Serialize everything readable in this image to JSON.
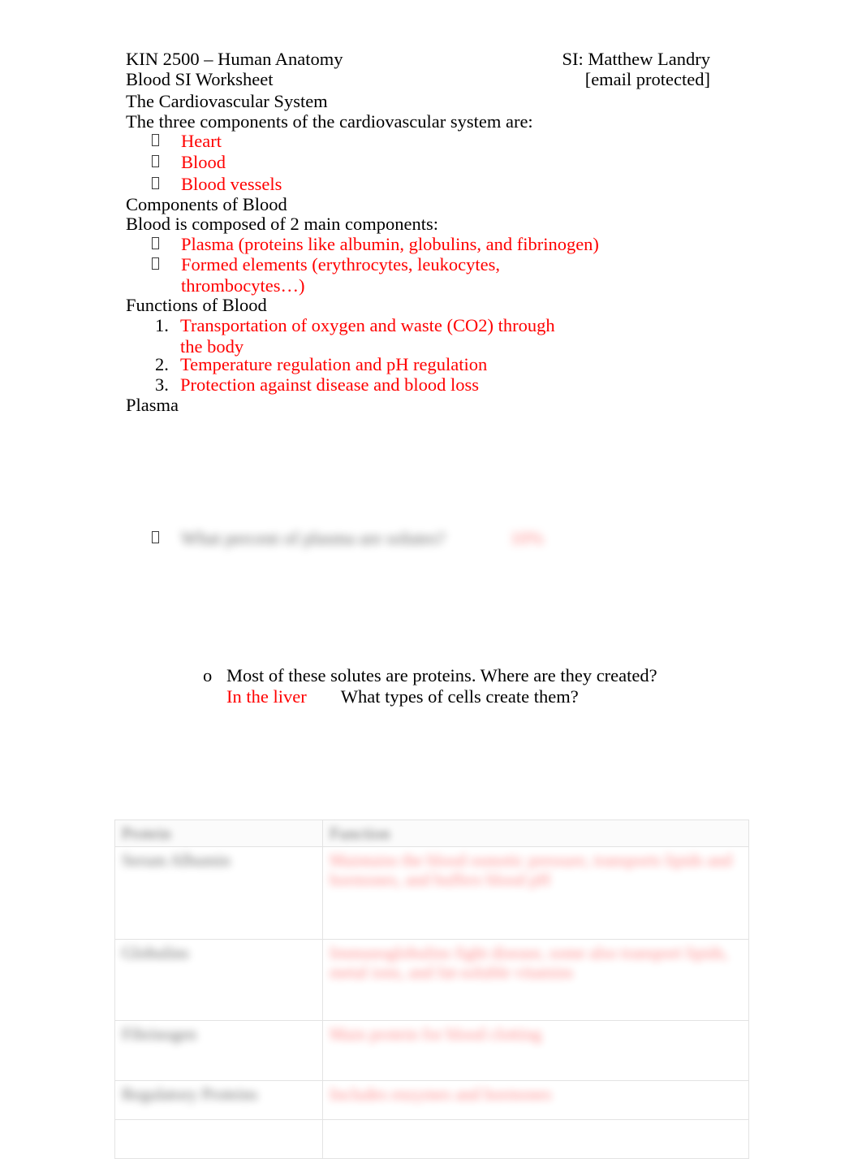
{
  "document": {
    "header": {
      "left_line1": "KIN 2500 – Human Anatomy",
      "right_line1": "SI: Matthew Landry",
      "left_line2": "Blood SI Worksheet",
      "right_line2": "[email protected]"
    },
    "section_cardiovascular": {
      "heading": "The Cardiovascular System",
      "prompt": "The three components of the cardiovascular system are:",
      "answers": [
        "Heart",
        "Blood",
        "Blood vessels"
      ]
    },
    "section_components": {
      "heading": "Components of Blood",
      "prompt": "Blood is composed of 2 main components:",
      "answers": [
        "Plasma (proteins like albumin, globulins, and fibrinogen)",
        "Formed elements (erythrocytes, leukocytes, thrombocytes…)"
      ]
    },
    "section_functions": {
      "heading": "Functions of Blood",
      "items": [
        {
          "number": "1.",
          "text": "Transportation of oxygen and waste (CO2) through the body"
        },
        {
          "number": "2.",
          "text": "Temperature regulation and pH regulation"
        },
        {
          "number": "3.",
          "text": "Protection against disease and blood loss"
        }
      ]
    },
    "section_plasma": {
      "heading": "Plasma",
      "redacted_question": {
        "bullet_glyph": "missing-glyph-box",
        "question_text": "What percent of plasma are solutes?",
        "answer_text": "10%",
        "state": "blurred"
      },
      "solutes_note": {
        "marker": "o",
        "text_before": "Most of these solutes are proteins. Where are they created?",
        "answer": "In the liver",
        "text_after": "What types of cells create them?"
      }
    },
    "table": {
      "state": "blurred",
      "columns": [
        "Protein",
        "Function"
      ],
      "rows": [
        {
          "name": "Serum Albumin",
          "function": "Maintains the blood osmotic pressure, transports lipids and hormones, and buffers blood pH"
        },
        {
          "name": "Globulins",
          "function": "Immunoglobulins fight disease, some also transport lipids, metal ions, and fat-soluble vitamins"
        },
        {
          "name": "Fibrinogen",
          "function": "Main protein for blood clotting"
        },
        {
          "name": "Regulatory Proteins",
          "function": "Includes enzymes and hormones"
        },
        {
          "name": "",
          "function": ""
        }
      ]
    }
  },
  "colors": {
    "answer_red": "#ff0000",
    "body_black": "#000000",
    "table_border": "#e3e3e3",
    "page_background": "#ffffff"
  }
}
